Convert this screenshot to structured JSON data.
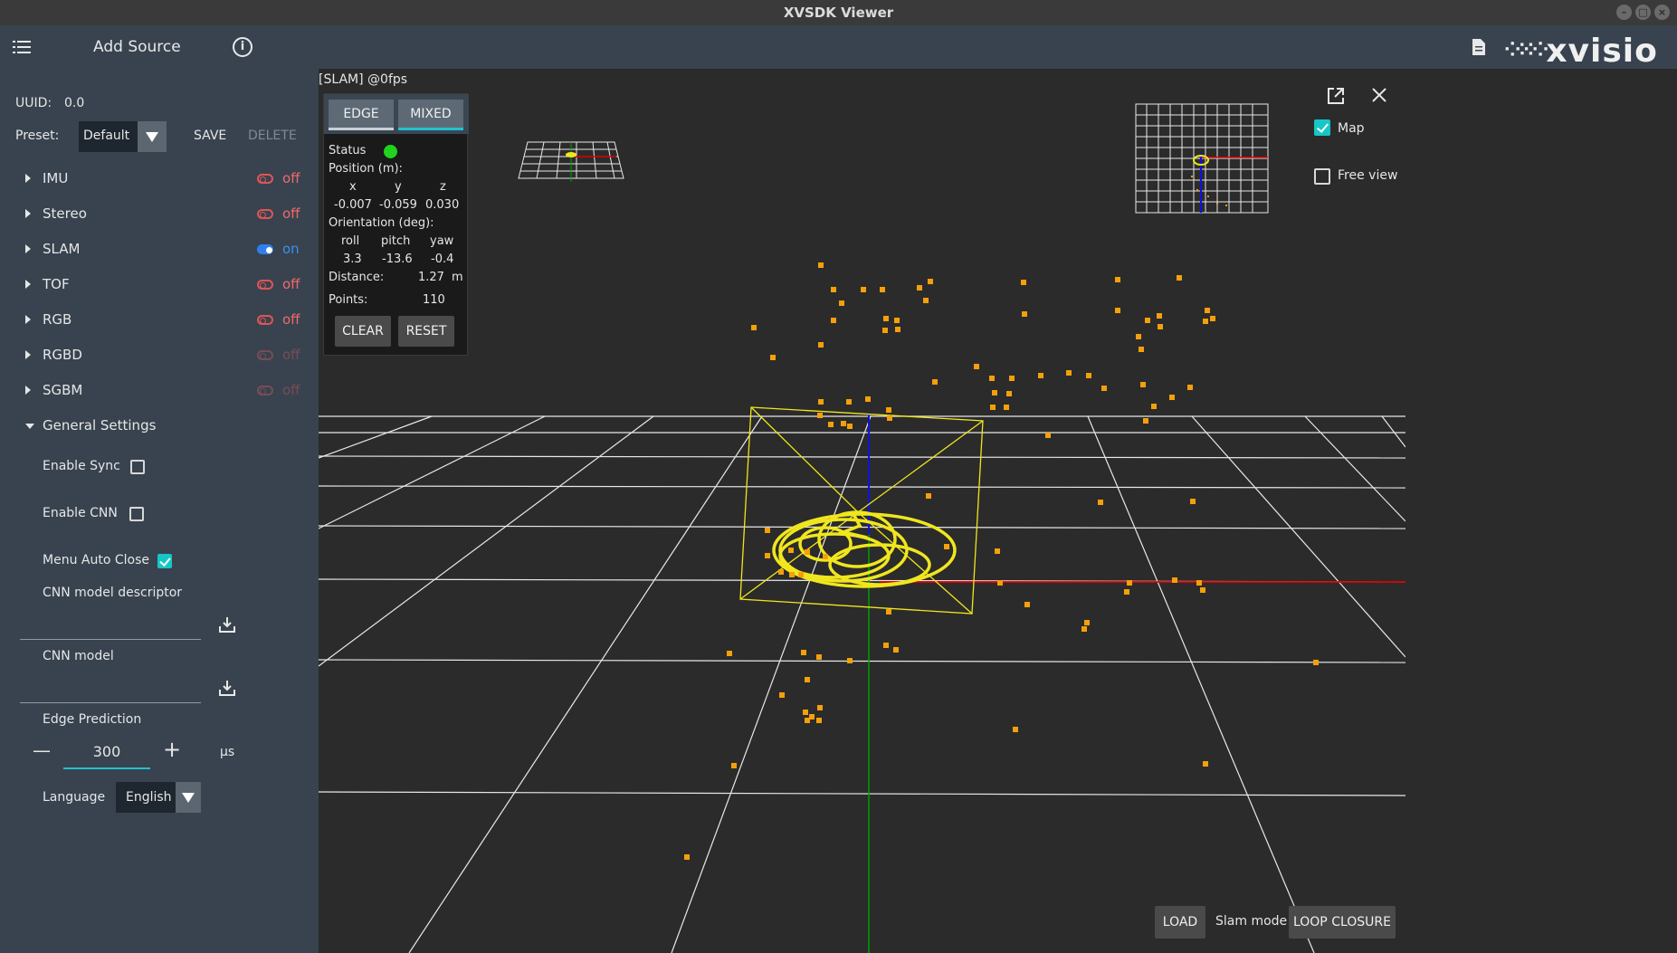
{
  "window": {
    "title": "XVSDK Viewer"
  },
  "toolbar": {
    "add_source": "Add Source",
    "logo_text": "xvisio"
  },
  "sidebar": {
    "uuid_label": "UUID:",
    "uuid_value": "0.0",
    "preset_label": "Preset:",
    "preset_value": "Default",
    "save_label": "SAVE",
    "delete_label": "DELETE",
    "items": [
      {
        "label": "IMU",
        "state": "off"
      },
      {
        "label": "Stereo",
        "state": "off"
      },
      {
        "label": "SLAM",
        "state": "on"
      },
      {
        "label": "TOF",
        "state": "off"
      },
      {
        "label": "RGB",
        "state": "off"
      },
      {
        "label": "RGBD",
        "state": "off"
      },
      {
        "label": "SGBM",
        "state": "off"
      }
    ],
    "general": {
      "label": "General Settings",
      "enable_sync": "Enable Sync",
      "enable_cnn": "Enable CNN",
      "menu_auto_close": "Menu Auto Close",
      "cnn_descriptor": "CNN model descriptor",
      "cnn_model": "CNN model",
      "edge_prediction": "Edge Prediction",
      "edge_value": "300",
      "edge_unit": "µs",
      "minus": "—",
      "plus": "+",
      "language_label": "Language",
      "language_value": "English"
    }
  },
  "viewport": {
    "title": "[SLAM]  @0fps",
    "panel": {
      "tab_edge": "EDGE",
      "tab_mixed": "MIXED",
      "status_label": "Status",
      "position_label": "Position (m):",
      "pos_headers": [
        "x",
        "y",
        "z"
      ],
      "pos_values": [
        "-0.007",
        "-0.059",
        "0.030"
      ],
      "orientation_label": "Orientation (deg):",
      "orient_headers": [
        "roll",
        "pitch",
        "yaw"
      ],
      "orient_values": [
        "3.3",
        "-13.6",
        "-0.4"
      ],
      "distance_label": "Distance:",
      "distance_value": "1.27",
      "distance_unit": "m",
      "points_label": "Points:",
      "points_value": "110",
      "clear": "CLEAR",
      "reset": "RESET"
    },
    "map_label": "Map",
    "free_view_label": "Free view",
    "load": "LOAD",
    "slam_mode": "Slam mode",
    "loop_closure": "LOOP CLOSURE"
  },
  "colors": {
    "accent": "#1fc3d0",
    "status_ok": "#1fd41f",
    "points": "#f5a00a",
    "trajectory": "#f0e61e",
    "axis_x": "#e00000",
    "axis_y": "#00a000",
    "axis_z": "#1010e0"
  }
}
